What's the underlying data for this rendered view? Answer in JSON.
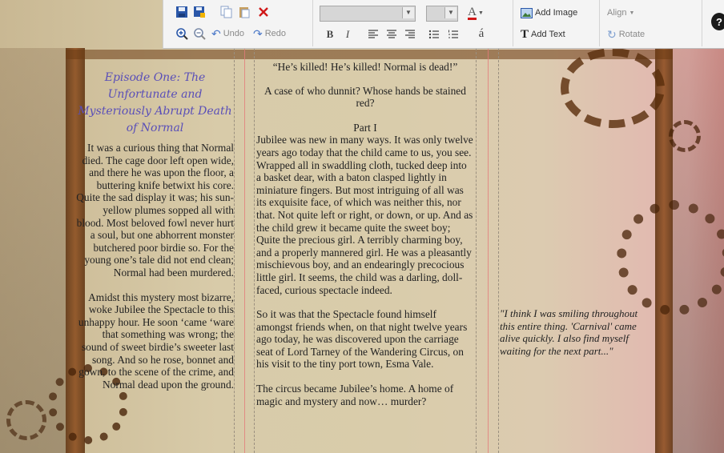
{
  "toolbar": {
    "undo_label": "Undo",
    "redo_label": "Redo",
    "add_image_label": "Add Image",
    "add_text_label": "Add Text",
    "align_label": "Align",
    "rotate_label": "Rotate",
    "bold_label": "B",
    "italic_label": "I",
    "accent_label": "á",
    "font_color_label": "A",
    "help_label": "?"
  },
  "left_page": {
    "title": "Episode One: The Unfortunate and Mysteriously Abrupt Death of Normal",
    "paragraph1": "It was a curious thing that Normal died. The cage door left open wide, and there he was upon the floor, a buttering knife betwixt his core. Quite the sad display it was; his sun-yellow plumes sopped all with blood. Most beloved fowl never hurt a soul, but one abhorrent monster butchered poor birdie so. For the young one’s tale did not end clean; Normal had been murdered.",
    "paragraph2": "Amidst this mystery most bizarre, woke Jubilee the Spectacle to this unhappy hour. He soon ‘came ‘ware that something was wrong; the sound of sweet birdie’s sweeter last song. And so he rose, bonnet and gown, to the scene of the crime, and Normal dead upon the ground."
  },
  "middle_page": {
    "heading": "“He’s killed! He’s killed! Normal is dead!”",
    "subheading": "A case of who dunnit? Whose hands be stained red?",
    "part": "Part I",
    "paragraph1": "Jubilee was new in many ways. It was only twelve years ago today that the child came to us, you see. Wrapped all in swaddling cloth, tucked deep into a basket dear, with a baton clasped lightly in miniature fingers. But most intriguing of all was its exquisite face, of which was neither this, nor that. Not quite left or right, or down, or up. And as the child grew it became quite the sweet boy; Quite the precious girl. A terribly charming boy, and a properly mannered girl. He was a pleasantly mischievous boy, and an endearingly precocious little girl. It seems, the child was a darling, doll-faced, curious spectacle indeed.",
    "paragraph2": "So it was that the Spectacle found himself amongst friends when, on that night twelve years ago today, he was discovered upon the carriage seat of Lord Tarney of the Wandering Circus, on his visit to the tiny port town, Esma Vale.",
    "paragraph3": "The circus became Jubilee’s home. A home of magic and mystery and now… murder?"
  },
  "right_page": {
    "quote": "\"I think I was smiling throughout this entire thing. 'Carnival' came alive quickly. I also find myself waiting for the next part...\""
  },
  "colors": {
    "title_color": "#5a4fb8",
    "rust": "#6b3a12",
    "toolbar_bg": "#f4f4f4",
    "guide_red": "#e37b7b"
  }
}
